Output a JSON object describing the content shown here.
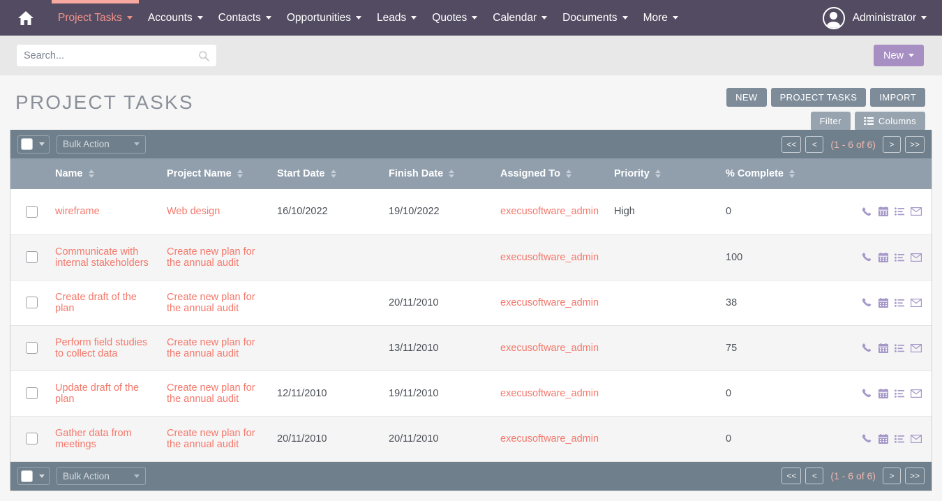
{
  "nav": {
    "home_icon": "home-icon",
    "items": [
      {
        "label": "Project Tasks",
        "active": true,
        "has_caret": true
      },
      {
        "label": "Accounts",
        "active": false,
        "has_caret": true
      },
      {
        "label": "Contacts",
        "active": false,
        "has_caret": true
      },
      {
        "label": "Opportunities",
        "active": false,
        "has_caret": true
      },
      {
        "label": "Leads",
        "active": false,
        "has_caret": true
      },
      {
        "label": "Quotes",
        "active": false,
        "has_caret": true
      },
      {
        "label": "Calendar",
        "active": false,
        "has_caret": true
      },
      {
        "label": "Documents",
        "active": false,
        "has_caret": true
      },
      {
        "label": "More",
        "active": false,
        "has_caret": true
      }
    ],
    "user": "Administrator",
    "avatar_icon": "user-avatar-icon",
    "accent_color": "#f7a9a0",
    "bg_color": "#534b62"
  },
  "search": {
    "value": "",
    "placeholder": "Search...",
    "icon": "search-icon"
  },
  "new_button": {
    "label": "New",
    "color": "#a78fc4"
  },
  "header": {
    "title": "PROJECT TASKS",
    "buttons": [
      {
        "label": "NEW"
      },
      {
        "label": "PROJECT TASKS"
      },
      {
        "label": "IMPORT"
      }
    ],
    "sub_buttons": [
      {
        "label": "Filter",
        "icon": null
      },
      {
        "label": "Columns",
        "icon": "columns-icon"
      }
    ]
  },
  "toolbar": {
    "select_all_icon": "checkbox-dropdown",
    "bulk_action_label": "Bulk Action",
    "pagination": {
      "first": "<<",
      "prev": "<",
      "count": "(1 - 6 of 6)",
      "next": ">",
      "last": ">>"
    }
  },
  "table": {
    "columns": [
      {
        "key": "name",
        "label": "Name"
      },
      {
        "key": "project",
        "label": "Project Name"
      },
      {
        "key": "start",
        "label": "Start Date"
      },
      {
        "key": "finish",
        "label": "Finish Date"
      },
      {
        "key": "assigned",
        "label": "Assigned To"
      },
      {
        "key": "priority",
        "label": "Priority"
      },
      {
        "key": "percent",
        "label": "% Complete"
      }
    ],
    "row_actions": [
      "phone-icon",
      "calendar-icon",
      "list-icon",
      "envelope-icon"
    ],
    "rows": [
      {
        "name": "wireframe",
        "project": "Web design",
        "start": "16/10/2022",
        "finish": "19/10/2022",
        "assigned": "execusoftware_admin",
        "priority": "High",
        "percent": "0"
      },
      {
        "name": "Communicate with internal stakeholders",
        "project": "Create new plan for the annual audit",
        "start": "",
        "finish": "",
        "assigned": "execusoftware_admin",
        "priority": "",
        "percent": "100"
      },
      {
        "name": "Create draft of the plan",
        "project": "Create new plan for the annual audit",
        "start": "",
        "finish": "20/11/2010",
        "assigned": "execusoftware_admin",
        "priority": "",
        "percent": "38"
      },
      {
        "name": "Perform field studies to collect data",
        "project": "Create new plan for the annual audit",
        "start": "",
        "finish": "13/11/2010",
        "assigned": "execusoftware_admin",
        "priority": "",
        "percent": "75"
      },
      {
        "name": "Update draft of the plan",
        "project": "Create new plan for the annual audit",
        "start": "12/11/2010",
        "finish": "19/11/2010",
        "assigned": "execusoftware_admin",
        "priority": "",
        "percent": "0"
      },
      {
        "name": "Gather data from meetings",
        "project": "Create new plan for the annual audit",
        "start": "20/11/2010",
        "finish": "20/11/2010",
        "assigned": "execusoftware_admin",
        "priority": "",
        "percent": "0"
      }
    ]
  },
  "colors": {
    "link": "#f4786b",
    "header_row": "#919fad",
    "toolbar": "#6f7f8c",
    "action_icon": "#a598c8"
  }
}
